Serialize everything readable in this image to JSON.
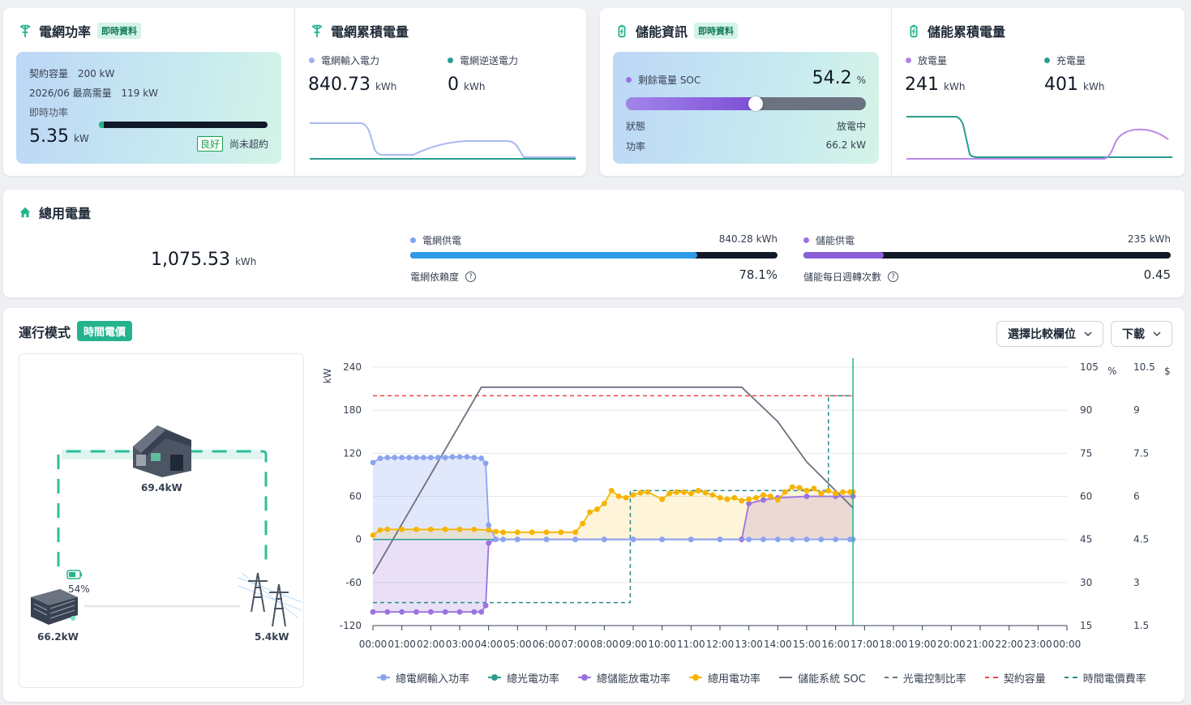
{
  "grid_power": {
    "title": "電網功率",
    "tag": "即時資料",
    "contract_label": "契約容量",
    "contract_value": "200 kW",
    "peak_label": "2026/06 最高需量",
    "peak_value": "119 kW",
    "instant_label": "即時功率",
    "instant_value": "5.35",
    "instant_unit": "kW",
    "instant_fraction": 0.03,
    "status_badge": "良好",
    "status_text": "尚未超約"
  },
  "grid_energy": {
    "title": "電網累積電量",
    "import_label": "電網輸入電力",
    "import_value": "840.73",
    "import_unit": "kWh",
    "export_label": "電網逆送電力",
    "export_value": "0",
    "export_unit": "kWh"
  },
  "storage_info": {
    "title": "儲能資訊",
    "tag": "即時資料",
    "soc_label": "剩餘電量 SOC",
    "soc_value": "54.2",
    "soc_unit": "%",
    "soc_fraction": 0.542,
    "state_label": "狀態",
    "state_value": "放電中",
    "power_label": "功率",
    "power_value": "66.2 kW"
  },
  "storage_energy": {
    "title": "儲能累積電量",
    "discharge_label": "放電量",
    "discharge_value": "241",
    "discharge_unit": "kWh",
    "charge_label": "充電量",
    "charge_value": "401",
    "charge_unit": "kWh"
  },
  "total": {
    "title": "總用電量",
    "value": "1,075.53",
    "unit": "kWh",
    "grid_supply_label": "電網供電",
    "grid_supply_value": "840.28 kWh",
    "grid_supply_fraction": 0.781,
    "grid_dependency_label": "電網依賴度",
    "grid_dependency_value": "78.1%",
    "storage_supply_label": "儲能供電",
    "storage_supply_value": "235 kWh",
    "storage_supply_fraction": 0.219,
    "storage_cycles_label": "儲能每日週轉次數",
    "storage_cycles_value": "0.45"
  },
  "mode": {
    "title": "運行模式",
    "badge": "時間電價",
    "compare_button": "選擇比較欄位",
    "download_button": "下載"
  },
  "flow": {
    "house_value": "69.4kW",
    "battery_soc": "54%",
    "battery_value": "66.2kW",
    "grid_value": "5.4kW"
  },
  "colors": {
    "accent": "#24b38d",
    "grid_import": "#8aa4f0",
    "solar": "#2a9d8f",
    "storage": "#9b72e0",
    "total_use": "#f6b400",
    "soc": "#6b7280",
    "contract": "#ef4444",
    "tou": "#2a8a8a"
  },
  "chart_data": {
    "type": "line",
    "ylabel_left": "kW",
    "ylabel_right1": "%",
    "ylabel_right2": "$",
    "ylim_left": [
      -120,
      240
    ],
    "yticks_left": [
      "240",
      "180",
      "120",
      "60",
      "0",
      "-60",
      "-120"
    ],
    "ylim_right1": [
      15,
      105
    ],
    "yticks_right1": [
      "105",
      "90",
      "75",
      "60",
      "45",
      "30",
      "15"
    ],
    "ylim_right2": [
      1.5,
      10.5
    ],
    "yticks_right2": [
      "10.5",
      "9",
      "7.5",
      "6",
      "4.5",
      "3",
      "1.5"
    ],
    "categories": [
      "00:00",
      "01:00",
      "02:00",
      "03:00",
      "04:00",
      "05:00",
      "06:00",
      "07:00",
      "08:00",
      "09:00",
      "10:00",
      "11:00",
      "12:00",
      "13:00",
      "14:00",
      "15:00",
      "16:00",
      "17:00",
      "18:00",
      "19:00",
      "20:00",
      "21:00",
      "22:00",
      "23:00",
      "00:00"
    ],
    "legend": [
      "總電網輸入功率",
      "總光電功率",
      "總儲能放電功率",
      "總用電功率",
      "儲能系統 SOC",
      "光電控制比率",
      "契約容量",
      "時間電價費率"
    ],
    "current_time_hours": 16.6,
    "series": [
      {
        "name": "總電網輸入功率",
        "axis": "kW",
        "x": [
          0,
          0.25,
          0.5,
          0.75,
          1,
          1.25,
          1.5,
          1.75,
          2,
          2.25,
          2.5,
          2.75,
          3,
          3.25,
          3.5,
          3.75,
          3.9,
          4.0,
          4.25,
          4.5,
          5,
          6,
          7,
          8,
          9,
          10,
          11,
          12,
          13,
          13.5,
          14,
          14.5,
          15,
          15.5,
          16,
          16.5,
          16.6
        ],
        "y": [
          107,
          113,
          114,
          114,
          114,
          114,
          114,
          114,
          114,
          114,
          114,
          115,
          115,
          115,
          114,
          113,
          106,
          20,
          0,
          0,
          0,
          0,
          0,
          0,
          0,
          0,
          0,
          0,
          0,
          0,
          0,
          0,
          0,
          0,
          0,
          0,
          0
        ]
      },
      {
        "name": "總光電功率",
        "axis": "kW",
        "x": [
          0,
          16.6
        ],
        "y": [
          0,
          0
        ]
      },
      {
        "name": "總儲能放電功率",
        "axis": "kW",
        "x": [
          0,
          0.5,
          1,
          1.5,
          2,
          2.5,
          3,
          3.5,
          3.75,
          3.9,
          4.0,
          4.25,
          5,
          6,
          7,
          8,
          9,
          10,
          11,
          12,
          12.75,
          13,
          13.5,
          14,
          15,
          16,
          16.6
        ],
        "y": [
          -101,
          -101,
          -101,
          -101,
          -101,
          -101,
          -101,
          -101,
          -101,
          -92,
          -5,
          0,
          0,
          0,
          0,
          0,
          0,
          0,
          0,
          0,
          0,
          50,
          55,
          58,
          60,
          60,
          60
        ]
      },
      {
        "name": "總用電功率",
        "axis": "kW",
        "x": [
          0,
          0.25,
          0.5,
          1,
          1.5,
          2,
          2.5,
          3,
          3.5,
          4,
          4.25,
          4.5,
          5,
          5.5,
          6,
          6.5,
          7,
          7.25,
          7.5,
          7.75,
          8,
          8.25,
          8.5,
          8.75,
          9,
          9.25,
          9.5,
          10,
          10.25,
          10.5,
          10.75,
          11,
          11.25,
          11.5,
          11.75,
          12,
          12.25,
          12.5,
          12.75,
          13,
          13.25,
          13.5,
          13.75,
          14,
          14.25,
          14.5,
          14.75,
          15,
          15.25,
          15.5,
          15.75,
          16,
          16.25,
          16.5,
          16.6
        ],
        "y": [
          6,
          13,
          14,
          14,
          14,
          14,
          14,
          14,
          14,
          13,
          11,
          10,
          10,
          10,
          10,
          10,
          10,
          22,
          38,
          42,
          50,
          68,
          60,
          58,
          62,
          65,
          66,
          56,
          64,
          66,
          66,
          64,
          68,
          65,
          62,
          58,
          56,
          58,
          54,
          56,
          58,
          62,
          60,
          55,
          66,
          73,
          72,
          68,
          71,
          64,
          68,
          64,
          66,
          66,
          66
        ]
      },
      {
        "name": "儲能系統 SOC",
        "axis": "%",
        "x": [
          0,
          3.75,
          4,
          12.75,
          14,
          15,
          16.6
        ],
        "y": [
          33,
          98,
          98,
          98,
          86,
          72,
          56
        ]
      },
      {
        "name": "光電控制比率",
        "axis": "%",
        "x": [],
        "y": []
      },
      {
        "name": "契約容量",
        "axis": "kW",
        "x": [
          0,
          16.6
        ],
        "y": [
          200,
          200
        ]
      },
      {
        "name": "時間電價費率",
        "axis": "$",
        "x": [
          0,
          8.9,
          8.9,
          15.75,
          15.75,
          16.6
        ],
        "y": [
          2.3,
          2.3,
          6.2,
          6.2,
          9.5,
          9.5
        ]
      }
    ]
  }
}
